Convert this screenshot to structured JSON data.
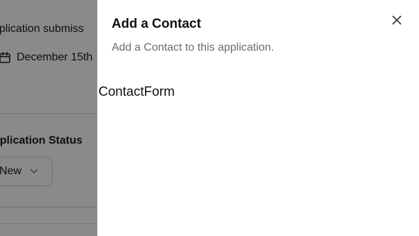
{
  "background_page": {
    "submitted_label": "pplication submiss",
    "submitted_date": "December 15th",
    "status_label": "pplication Status",
    "status_value": "New"
  },
  "drawer": {
    "title": "Add a Contact",
    "description": "Add a Contact to this application.",
    "body_placeholder": "ContactForm",
    "close_icon": "close-icon"
  },
  "colors": {
    "overlay": "#000000",
    "drawer_bg": "#ffffff",
    "muted_text": "#6b6b6b"
  }
}
